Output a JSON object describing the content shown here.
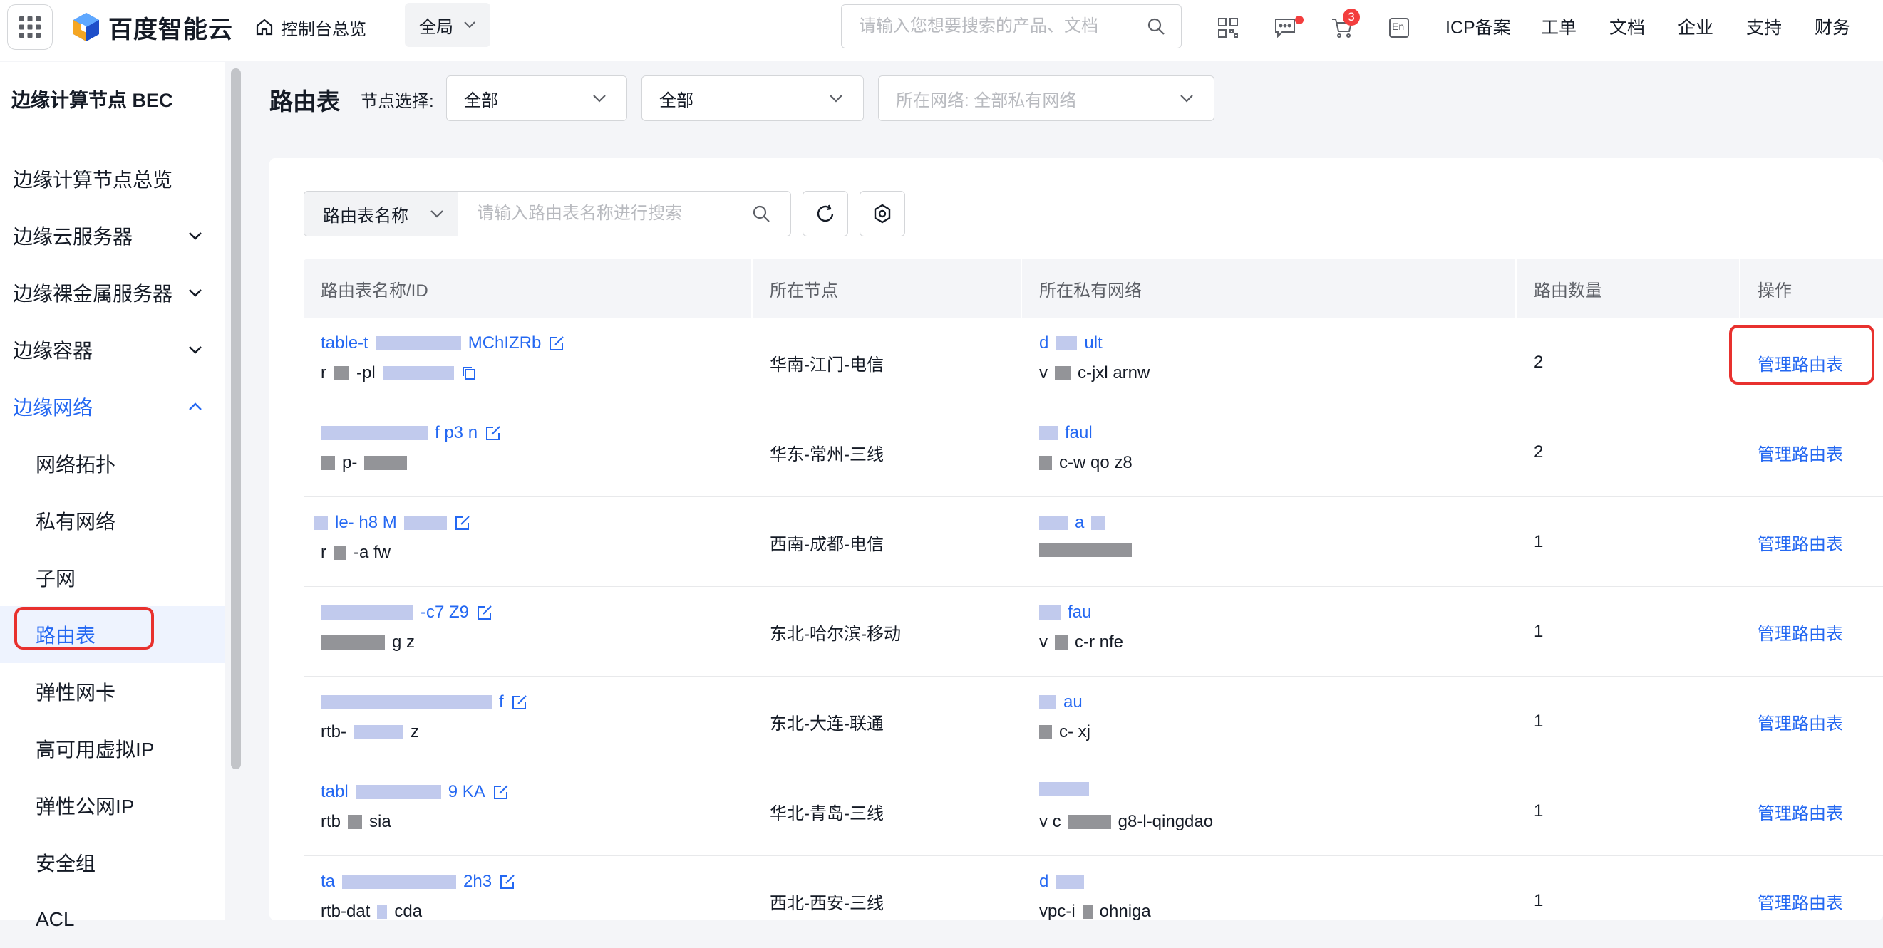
{
  "header": {
    "logo_text": "百度智能云",
    "console_home": "控制台总览",
    "region": "全局",
    "search_placeholder": "请输入您想要搜索的产品、文档",
    "cart_count": "3",
    "lang": "En",
    "links": [
      "ICP备案",
      "工单",
      "文档",
      "企业",
      "支持",
      "财务"
    ]
  },
  "sidebar": {
    "title": "边缘计算节点 BEC",
    "items": [
      {
        "label": "边缘计算节点总览"
      },
      {
        "label": "边缘云服务器"
      },
      {
        "label": "边缘裸金属服务器"
      },
      {
        "label": "边缘容器"
      },
      {
        "label": "边缘网络"
      },
      {
        "label": "网络拓扑"
      },
      {
        "label": "私有网络"
      },
      {
        "label": "子网"
      },
      {
        "label": "路由表"
      },
      {
        "label": "弹性网卡"
      },
      {
        "label": "高可用虚拟IP"
      },
      {
        "label": "弹性公网IP"
      },
      {
        "label": "安全组"
      },
      {
        "label": "ACL"
      }
    ]
  },
  "page": {
    "title": "路由表",
    "node_label": "节点选择:",
    "node_select_1": "全部",
    "node_select_2": "全部",
    "network_select": "所在网络: 全部私有网络"
  },
  "toolbar": {
    "search_type": "路由表名称",
    "search_placeholder": "请输入路由表名称进行搜索"
  },
  "table": {
    "columns": [
      "路由表名称/ID",
      "所在节点",
      "所在私有网络",
      "路由数量",
      "操作"
    ],
    "rows": [
      {
        "name": "table-t",
        "name_tail": "MChIZRb",
        "id": "r",
        "id_tail": "-pl",
        "node": "华南-江门-电信",
        "vpc_name": "d",
        "vpc_name_tail": "ult",
        "vpc_id": "v",
        "vpc_id_tail": "c-jxl arnw",
        "count": "2",
        "action": "管理路由表"
      },
      {
        "name": "",
        "name_tail": "f p3 n",
        "id": "",
        "id_tail": "p-",
        "node": "华东-常州-三线",
        "vpc_name": "",
        "vpc_name_tail": "faul",
        "vpc_id": "",
        "vpc_id_tail": "c-w qo z8",
        "count": "2",
        "action": "管理路由表"
      },
      {
        "name": "",
        "name_tail": "le- h8 M",
        "id": "r",
        "id_tail": "-a fw",
        "node": "西南-成都-电信",
        "vpc_name": "",
        "vpc_name_tail": "a",
        "vpc_id": "",
        "vpc_id_tail": "",
        "count": "1",
        "action": "管理路由表"
      },
      {
        "name": "",
        "name_tail": "-c7 Z9",
        "id": "",
        "id_tail": "g z",
        "node": "东北-哈尔滨-移动",
        "vpc_name": "",
        "vpc_name_tail": "fau",
        "vpc_id": "v",
        "vpc_id_tail": "c-r nfe",
        "count": "1",
        "action": "管理路由表"
      },
      {
        "name": "",
        "name_tail": "f",
        "id": "rtb-",
        "id_tail": "z",
        "node": "东北-大连-联通",
        "vpc_name": "",
        "vpc_name_tail": "au",
        "vpc_id": "",
        "vpc_id_tail": "c- xj",
        "count": "1",
        "action": "管理路由表"
      },
      {
        "name": "tabl",
        "name_tail": "9 KA",
        "id": "rtb",
        "id_tail": "sia",
        "node": "华北-青岛-三线",
        "vpc_name": "",
        "vpc_name_tail": "",
        "vpc_id": "v c",
        "vpc_id_tail": "g8-l-qingdao",
        "count": "1",
        "action": "管理路由表"
      },
      {
        "name": "ta",
        "name_tail": "2h3",
        "id": "rtb-dat",
        "id_tail": "cda",
        "node": "西北-西安-三线",
        "vpc_name": "d",
        "vpc_name_tail": "",
        "vpc_id": "vpc-i",
        "vpc_id_tail": "ohniga",
        "count": "1",
        "action": "管理路由表"
      }
    ]
  },
  "colors": {
    "accent": "#2468f2",
    "highlight_box": "#e8312e",
    "badge": "#f33e3e"
  }
}
